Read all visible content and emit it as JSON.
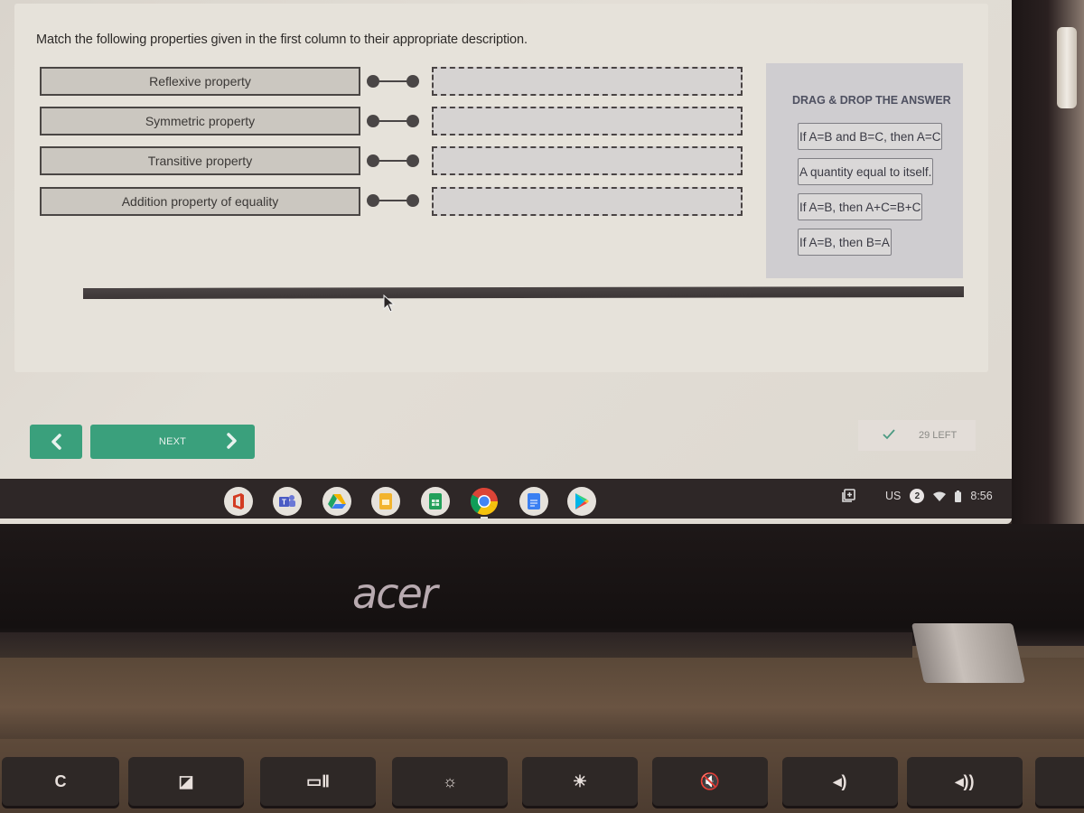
{
  "quiz": {
    "question": "Match the following properties given in the first column to their appropriate description.",
    "properties": [
      {
        "label": "Reflexive property"
      },
      {
        "label": "Symmetric property"
      },
      {
        "label": "Transitive property"
      },
      {
        "label": "Addition property of equality"
      }
    ],
    "drop_zones": [
      "",
      "",
      "",
      ""
    ],
    "answer_panel": {
      "title": "DRAG & DROP THE ANSWER",
      "answers": [
        {
          "label": "If A=B and B=C, then A=C"
        },
        {
          "label": "A quantity equal to itself."
        },
        {
          "label": "If A=B, then A+C=B+C"
        },
        {
          "label": "If A=B, then B=A"
        }
      ]
    }
  },
  "navigation": {
    "prev_icon": "chevron-left-icon",
    "next_label": "NEXT",
    "next_icon": "chevron-right-icon",
    "accent_color": "#3aa07c"
  },
  "status": {
    "icon": "checkmark-icon",
    "remaining_text": "29 LEFT"
  },
  "shelf": {
    "apps": [
      {
        "name": "Microsoft Office",
        "icon": "office-icon"
      },
      {
        "name": "Microsoft Teams",
        "icon": "teams-icon"
      },
      {
        "name": "Google Drive",
        "icon": "drive-icon"
      },
      {
        "name": "Google Slides",
        "icon": "slides-icon"
      },
      {
        "name": "Google Sheets",
        "icon": "sheets-icon"
      },
      {
        "name": "Google Chrome",
        "icon": "chrome-icon"
      },
      {
        "name": "Google Docs",
        "icon": "docs-icon"
      },
      {
        "name": "Google Play",
        "icon": "play-store-icon"
      }
    ],
    "tray": {
      "screenshot_icon": "screen-capture-icon",
      "keyboard_layout": "US",
      "notification_count": "2",
      "wifi_icon": "wifi-icon",
      "battery_icon": "battery-icon",
      "time": "8:56"
    }
  },
  "laptop": {
    "brand": "acer",
    "keys": [
      {
        "icon": "refresh-icon",
        "glyph": "C"
      },
      {
        "icon": "fullscreen-icon",
        "glyph": "◪"
      },
      {
        "icon": "overview-icon",
        "glyph": "▭Ⅱ"
      },
      {
        "icon": "brightness-down-icon",
        "glyph": "☼"
      },
      {
        "icon": "brightness-up-icon",
        "glyph": "☀"
      },
      {
        "icon": "mute-icon",
        "glyph": "🔇"
      },
      {
        "icon": "volume-down-icon",
        "glyph": "◂)"
      },
      {
        "icon": "volume-up-icon",
        "glyph": "◂))"
      }
    ]
  }
}
